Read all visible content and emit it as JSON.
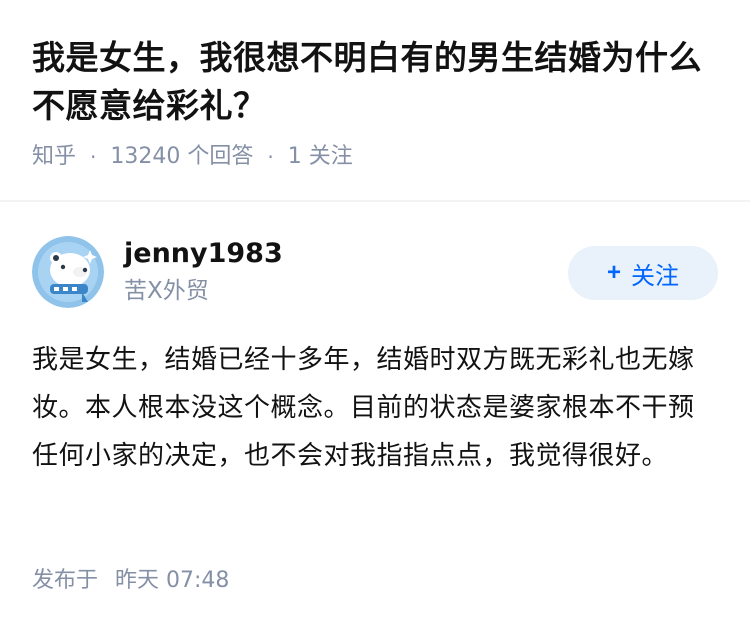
{
  "question": {
    "title": "我是女生，我很想不明白有的男生结婚为什么不愿意给彩礼？",
    "source": "知乎",
    "answer_count": "13240 个回答",
    "follower_count": "1 关注"
  },
  "answer": {
    "author": {
      "name": "jenny1983",
      "bio": "苦X外贸",
      "avatar_icon": "polar-bear-avatar-icon"
    },
    "follow_button": {
      "icon": "+",
      "label": "关注"
    },
    "content": "我是女生，结婚已经十多年，结婚时双方既无彩礼也无嫁妆。本人根本没这个概念。目前的状态是婆家根本不干预任何小家的决定，也不会对我指指点点，我觉得很好。",
    "published_label": "发布于",
    "published_time": "昨天 07:48"
  },
  "colors": {
    "text_primary": "#121212",
    "text_secondary": "#8590a6",
    "accent": "#0066ff",
    "follow_bg": "#e9f1fb"
  }
}
